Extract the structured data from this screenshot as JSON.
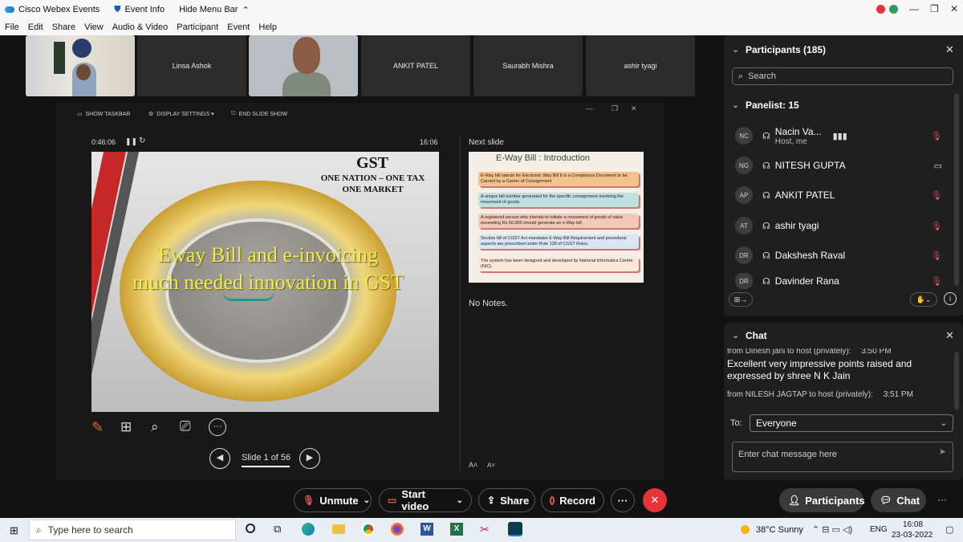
{
  "titlebar": {
    "app": "Cisco Webex Events",
    "event_info": "Event Info",
    "hide_menu": "Hide Menu Bar"
  },
  "menu": [
    "File",
    "Edit",
    "Share",
    "View",
    "Audio & Video",
    "Participant",
    "Event",
    "Help"
  ],
  "video_tiles": [
    "Linsa Ashok",
    "ANKIT PATEL",
    "Saurabh Mishra",
    "ashir tyagi"
  ],
  "ppt": {
    "show_taskbar": "SHOW TASKBAR",
    "display_settings": "DISPLAY SETTINGS ▾",
    "end_show": "END SLIDE SHOW",
    "elapsed": "0:46:06",
    "clock": "16:06",
    "next_slide_label": "Next slide",
    "notes": "No Notes.",
    "slide_counter": "Slide 1 of 56"
  },
  "slide": {
    "gst": "GST",
    "tagline1": "ONE NATION – ONE TAX",
    "tagline2": "ONE MARKET",
    "headline1": "Eway Bill and e-invoicing",
    "headline2": "much needed innovation in GST"
  },
  "next_slide": {
    "title": "E-Way Bill : Introduction",
    "points": [
      "E-Way bill stands for Electronic Way Bill It is a Compliance Document to be Carried by a Carrier of Consignment",
      "A unique bill number generated for the specific consignment involving the movement of goods",
      "A registered person who intends to initiate a movement of goods of value exceeding Rs 50,000 should generate an e-Way bill",
      "Section 68 of CGST Act mandates E-Way Bill Requirement and procedural aspects are prescribed under Rule 138 of CGST Rules.",
      "The system has been designed and developed by National Informatics Centre (NIC)."
    ]
  },
  "participants": {
    "title": "Participants (185)",
    "search_placeholder": "Search",
    "panelist_header": "Panelist: 15",
    "list": [
      {
        "initials": "NC",
        "name": "Nacin Va...",
        "sub": "Host, me"
      },
      {
        "initials": "NG",
        "name": "NITESH GUPTA",
        "sub": ""
      },
      {
        "initials": "AP",
        "name": "ANKIT PATEL",
        "sub": ""
      },
      {
        "initials": "AT",
        "name": "ashir tyagi",
        "sub": ""
      },
      {
        "initials": "DR",
        "name": "Dakshesh Raval",
        "sub": ""
      },
      {
        "initials": "DR",
        "name": "Davinder Rana",
        "sub": ""
      }
    ]
  },
  "chat": {
    "title": "Chat",
    "msg1_from": "from Dinesh jani to host (privately):",
    "msg1_time": "3:50 PM",
    "msg1_text": "Excellent  very impressive points raised and expressed by shree N K Jain",
    "msg2_from": "from NILESH JAGTAP to host (privately):",
    "msg2_time": "3:51 PM",
    "to_label": "To:",
    "to_value": "Everyone",
    "input_placeholder": "Enter chat message here"
  },
  "controls": {
    "unmute": "Unmute",
    "start_video": "Start video",
    "share": "Share",
    "record": "Record",
    "more": "···",
    "participants": "Participants",
    "chat": "Chat"
  },
  "taskbar": {
    "search_placeholder": "Type here to search",
    "weather": "38°C  Sunny",
    "lang": "ENG",
    "time": "16:08",
    "date": "23-03-2022"
  },
  "colors": {
    "accent_red": "#e5333a",
    "mic_off": "#e05555"
  }
}
